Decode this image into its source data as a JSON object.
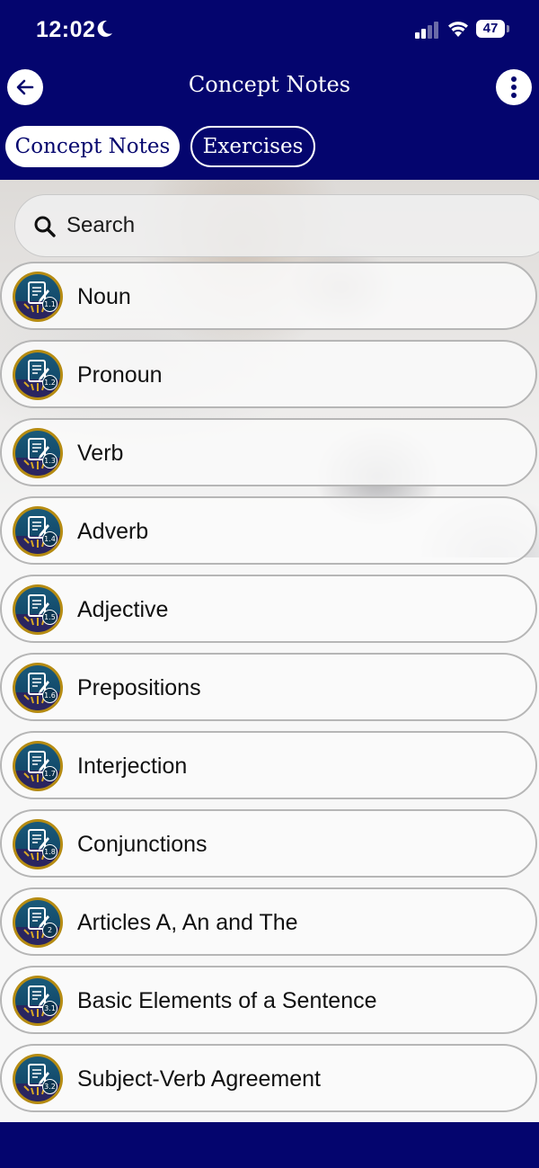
{
  "status_bar": {
    "time": "12:02",
    "battery": "47"
  },
  "header": {
    "title": "Concept Notes"
  },
  "tabs": [
    {
      "label": "Concept Notes",
      "active": true
    },
    {
      "label": "Exercises",
      "active": false
    }
  ],
  "search": {
    "placeholder": "Search"
  },
  "topics": [
    {
      "label": "Noun",
      "badge": "1.1"
    },
    {
      "label": "Pronoun",
      "badge": "1.2"
    },
    {
      "label": "Verb",
      "badge": "1.3"
    },
    {
      "label": "Adverb",
      "badge": "1.4"
    },
    {
      "label": "Adjective",
      "badge": "1.5"
    },
    {
      "label": "Prepositions",
      "badge": "1.6"
    },
    {
      "label": "Interjection",
      "badge": "1.7"
    },
    {
      "label": "Conjunctions",
      "badge": "1.8"
    },
    {
      "label": "Articles A, An and The",
      "badge": "2"
    },
    {
      "label": "Basic Elements of a Sentence",
      "badge": "3.1"
    },
    {
      "label": "Subject-Verb Agreement",
      "badge": "3.2"
    }
  ],
  "colors": {
    "primary": "#04056e",
    "badge_gold": "#b58b12",
    "badge_teal": "#1a5a7a"
  }
}
